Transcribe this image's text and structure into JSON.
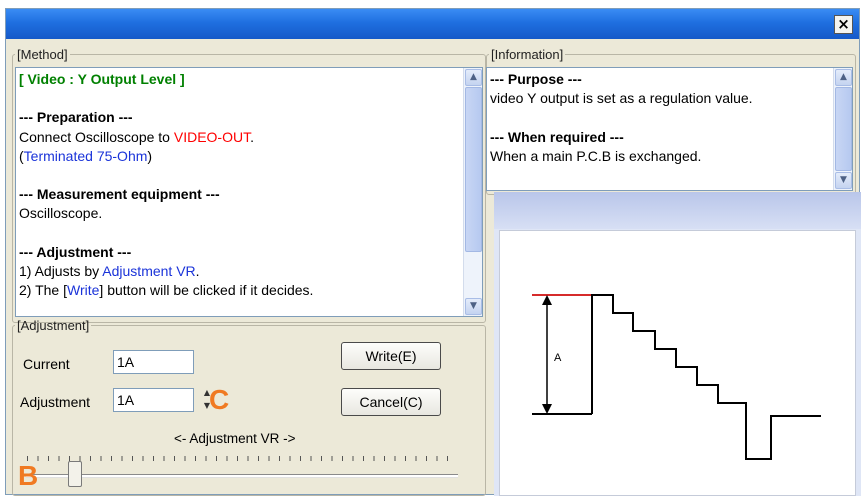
{
  "window": {
    "close_label": "×"
  },
  "method": {
    "legend": "[Method]",
    "title": "[ Video : Y Output Level ]",
    "preparation_heading": "--- Preparation ---",
    "preparation_text_prefix": "Connect Oscilloscope to ",
    "preparation_text_link": "VIDEO-OUT",
    "preparation_text_suffix": ".",
    "preparation_note_open": "(",
    "preparation_note_link": "Terminated 75-Ohm",
    "preparation_note_close": ")",
    "equipment_heading": "--- Measurement equipment ---",
    "equipment_text": "Oscilloscope.",
    "adjustment_heading": "--- Adjustment ---",
    "step1_prefix": "1) Adjusts by ",
    "step1_link": "Adjustment VR",
    "step1_suffix": ".",
    "step2_prefix": "2) The [",
    "step2_link": "Write",
    "step2_suffix": "] button will be clicked if it decides."
  },
  "information": {
    "legend": "[Information]",
    "purpose_heading": "--- Purpose ---",
    "purpose_text": "video Y output is set as a regulation value.",
    "when_heading": "--- When required ---",
    "when_text": "When a main P.C.B is exchanged."
  },
  "adjustment": {
    "legend": "[Adjustment]",
    "current_label": "Current",
    "current_value": "1A",
    "adjustment_label": "Adjustment",
    "adjustment_value": "1A",
    "write_button": "Write(E)",
    "cancel_button": "Cancel(C)",
    "vr_label": "<- Adjustment VR ->",
    "slider_position": 0.1
  },
  "markers": {
    "spinner_marker": "C",
    "slider_marker": "B"
  },
  "graph": {
    "amplitude_label": "A"
  },
  "scroll_arrows": {
    "up": "▲",
    "down": "▼"
  },
  "colors": {
    "link_red": "#ff0000",
    "link_blue": "#1a33d9",
    "title_green": "#008000",
    "marker_orange": "#f07a22",
    "baseline_red": "#d62b2b"
  }
}
